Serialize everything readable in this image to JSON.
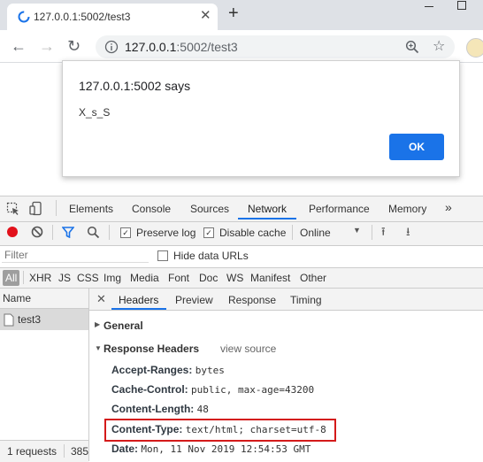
{
  "browser": {
    "tab_title": "127.0.0.1:5002/test3",
    "url_host": "127.0.0.1",
    "url_rest": ":5002/test3"
  },
  "dialog": {
    "title": "127.0.0.1:5002 says",
    "message": "X_s_S",
    "ok_label": "OK"
  },
  "devtools": {
    "tabs": [
      "Elements",
      "Console",
      "Sources",
      "Network",
      "Performance",
      "Memory",
      "»"
    ],
    "toolbar": {
      "preserve_log": "Preserve log",
      "disable_cache": "Disable cache",
      "throttle": "Online"
    },
    "filter": {
      "placeholder": "Filter",
      "hide_data_urls": "Hide data URLs"
    },
    "types": [
      "All",
      "XHR",
      "JS",
      "CSS",
      "Img",
      "Media",
      "Font",
      "Doc",
      "WS",
      "Manifest",
      "Other"
    ],
    "name_header": "Name",
    "request_name": "test3",
    "status": "1 requests",
    "status_cut": "385",
    "detail_tabs": [
      "Headers",
      "Preview",
      "Response",
      "Timing"
    ],
    "general_label": "General",
    "response_headers_label": "Response Headers",
    "view_source": "view source",
    "headers": [
      {
        "key": "Accept-Ranges:",
        "value": "bytes"
      },
      {
        "key": "Cache-Control:",
        "value": "public, max-age=43200"
      },
      {
        "key": "Content-Length:",
        "value": "48"
      },
      {
        "key": "Content-Type:",
        "value": "text/html; charset=utf-8"
      },
      {
        "key": "Date:",
        "value": "Mon, 11 Nov 2019 12:54:53 GMT"
      }
    ]
  }
}
